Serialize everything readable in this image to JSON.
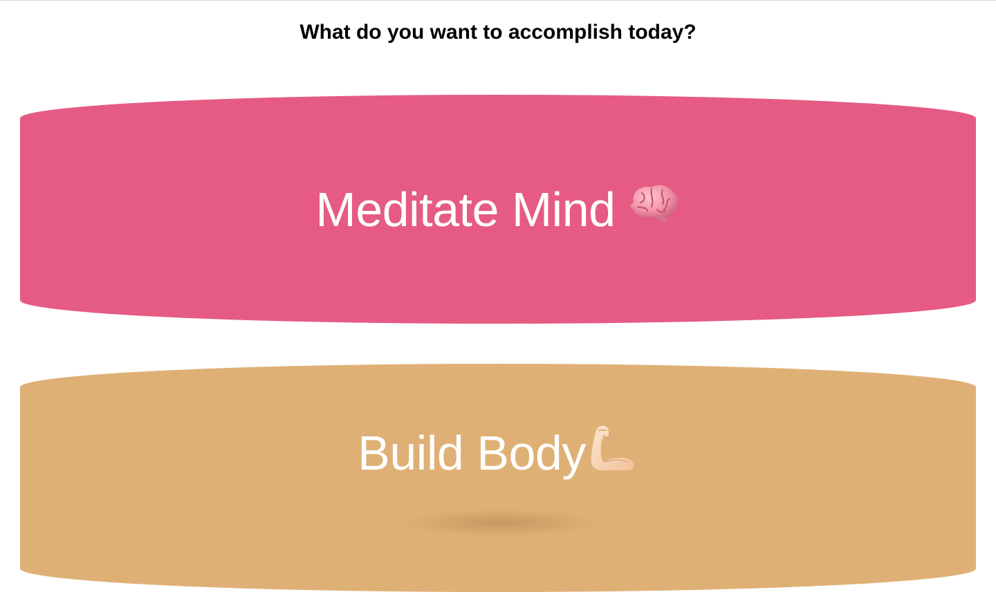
{
  "page": {
    "title": "What do you want to accomplish today?"
  },
  "options": [
    {
      "label": "Meditate Mind",
      "icon": "brain-icon",
      "color": "#e55b84"
    },
    {
      "label": "Build Body",
      "icon": "flexed-biceps-icon",
      "color": "#dfb075"
    }
  ]
}
